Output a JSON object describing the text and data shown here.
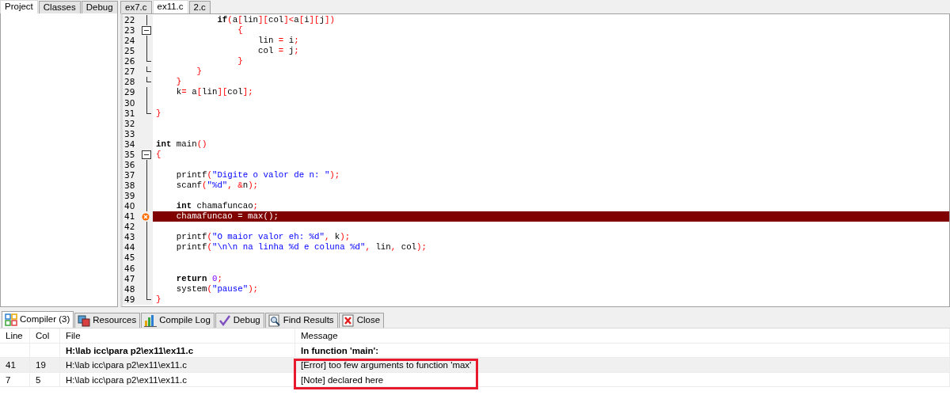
{
  "left_panel": {
    "tabs": [
      {
        "label": "Project",
        "selected": true
      },
      {
        "label": "Classes",
        "selected": false
      },
      {
        "label": "Debug",
        "selected": false
      }
    ]
  },
  "editor": {
    "tabs": [
      {
        "label": "ex7.c",
        "selected": false
      },
      {
        "label": "ex11.c",
        "selected": true
      },
      {
        "label": "2.c",
        "selected": false
      }
    ],
    "lines": [
      {
        "number": "22",
        "kind": "inside",
        "tokens": [
          {
            "kind": "kw",
            "text": "            if"
          },
          {
            "kind": "sym",
            "text": "("
          },
          {
            "kind": "id",
            "text": "a"
          },
          {
            "kind": "sym",
            "text": "["
          },
          {
            "kind": "id",
            "text": "lin"
          },
          {
            "kind": "sym",
            "text": "]["
          },
          {
            "kind": "id",
            "text": "col"
          },
          {
            "kind": "sym",
            "text": "]<"
          },
          {
            "kind": "id",
            "text": "a"
          },
          {
            "kind": "sym",
            "text": "["
          },
          {
            "kind": "id",
            "text": "i"
          },
          {
            "kind": "sym",
            "text": "]["
          },
          {
            "kind": "id",
            "text": "j"
          },
          {
            "kind": "sym",
            "text": "])"
          }
        ]
      },
      {
        "number": "23",
        "kind": "start",
        "tokens": [
          {
            "kind": "sym",
            "text": "                {"
          }
        ]
      },
      {
        "number": "24",
        "kind": "inside",
        "tokens": [
          {
            "kind": "id",
            "text": "                    lin "
          },
          {
            "kind": "sym",
            "text": "="
          },
          {
            "kind": "id",
            "text": " i"
          },
          {
            "kind": "sym",
            "text": ";"
          }
        ]
      },
      {
        "number": "25",
        "kind": "inside",
        "tokens": [
          {
            "kind": "id",
            "text": "                    col "
          },
          {
            "kind": "sym",
            "text": "="
          },
          {
            "kind": "id",
            "text": " j"
          },
          {
            "kind": "sym",
            "text": ";"
          }
        ]
      },
      {
        "number": "26",
        "kind": "end",
        "tokens": [
          {
            "kind": "sym",
            "text": "                }"
          }
        ]
      },
      {
        "number": "27",
        "kind": "end",
        "tokens": [
          {
            "kind": "sym",
            "text": "        }"
          }
        ]
      },
      {
        "number": "28",
        "kind": "end",
        "tokens": [
          {
            "kind": "sym",
            "text": "    }"
          }
        ]
      },
      {
        "number": "29",
        "kind": "inside",
        "tokens": [
          {
            "kind": "id",
            "text": "    k"
          },
          {
            "kind": "sym",
            "text": "="
          },
          {
            "kind": "id",
            "text": " a"
          },
          {
            "kind": "sym",
            "text": "["
          },
          {
            "kind": "id",
            "text": "lin"
          },
          {
            "kind": "sym",
            "text": "]["
          },
          {
            "kind": "id",
            "text": "col"
          },
          {
            "kind": "sym",
            "text": "];"
          }
        ]
      },
      {
        "number": "30",
        "kind": "inside"
      },
      {
        "number": "31",
        "kind": "end",
        "tokens": [
          {
            "kind": "sym",
            "text": "}"
          }
        ]
      },
      {
        "number": "32",
        "kind": "none"
      },
      {
        "number": "33",
        "kind": "none"
      },
      {
        "number": "34",
        "kind": "none",
        "tokens": [
          {
            "kind": "kw",
            "text": "int"
          },
          {
            "kind": "id",
            "text": " main"
          },
          {
            "kind": "sym",
            "text": "()"
          }
        ]
      },
      {
        "number": "35",
        "kind": "start",
        "tokens": [
          {
            "kind": "sym",
            "text": "{"
          }
        ]
      },
      {
        "number": "36",
        "kind": "inside"
      },
      {
        "number": "37",
        "kind": "inside",
        "tokens": [
          {
            "kind": "id",
            "text": "    printf"
          },
          {
            "kind": "sym",
            "text": "("
          },
          {
            "kind": "str",
            "text": "\"Digite o valor de n: \""
          },
          {
            "kind": "sym",
            "text": ");"
          }
        ]
      },
      {
        "number": "38",
        "kind": "inside",
        "tokens": [
          {
            "kind": "id",
            "text": "    scanf"
          },
          {
            "kind": "sym",
            "text": "("
          },
          {
            "kind": "str",
            "text": "\"%d\""
          },
          {
            "kind": "sym",
            "text": ", &"
          },
          {
            "kind": "id",
            "text": "n"
          },
          {
            "kind": "sym",
            "text": ");"
          }
        ]
      },
      {
        "number": "39",
        "kind": "inside"
      },
      {
        "number": "40",
        "kind": "inside",
        "tokens": [
          {
            "kind": "kw",
            "text": "    int"
          },
          {
            "kind": "id",
            "text": " chamafuncao"
          },
          {
            "kind": "sym",
            "text": ";"
          }
        ]
      },
      {
        "number": "41",
        "kind": "inside",
        "error": true,
        "tokens": [
          {
            "kind": "id",
            "text": "    chamafuncao "
          },
          {
            "kind": "sym",
            "text": "="
          },
          {
            "kind": "id",
            "text": " max"
          },
          {
            "kind": "sym",
            "text": "();"
          }
        ]
      },
      {
        "number": "42",
        "kind": "inside"
      },
      {
        "number": "43",
        "kind": "inside",
        "tokens": [
          {
            "kind": "id",
            "text": "    printf"
          },
          {
            "kind": "sym",
            "text": "("
          },
          {
            "kind": "str",
            "text": "\"O maior valor eh: %d\""
          },
          {
            "kind": "sym",
            "text": ", "
          },
          {
            "kind": "id",
            "text": "k"
          },
          {
            "kind": "sym",
            "text": ");"
          }
        ]
      },
      {
        "number": "44",
        "kind": "inside",
        "tokens": [
          {
            "kind": "id",
            "text": "    printf"
          },
          {
            "kind": "sym",
            "text": "("
          },
          {
            "kind": "str",
            "text": "\"\\n\\n na linha %d e coluna %d\""
          },
          {
            "kind": "sym",
            "text": ", "
          },
          {
            "kind": "id",
            "text": "lin"
          },
          {
            "kind": "sym",
            "text": ", "
          },
          {
            "kind": "id",
            "text": "col"
          },
          {
            "kind": "sym",
            "text": ");"
          }
        ]
      },
      {
        "number": "45",
        "kind": "inside"
      },
      {
        "number": "46",
        "kind": "inside"
      },
      {
        "number": "47",
        "kind": "inside",
        "tokens": [
          {
            "kind": "kw",
            "text": "    return"
          },
          {
            "kind": "num",
            "text": " 0"
          },
          {
            "kind": "sym",
            "text": ";"
          }
        ]
      },
      {
        "number": "48",
        "kind": "inside",
        "tokens": [
          {
            "kind": "id",
            "text": "    system"
          },
          {
            "kind": "sym",
            "text": "("
          },
          {
            "kind": "str",
            "text": "\"pause\""
          },
          {
            "kind": "sym",
            "text": ");"
          }
        ]
      },
      {
        "number": "49",
        "kind": "end",
        "tokens": [
          {
            "kind": "sym",
            "text": "}"
          }
        ]
      }
    ]
  },
  "bottom_tabs": [
    {
      "label": "Compiler (3)",
      "kind": "grid",
      "selected": true
    },
    {
      "label": "Resources",
      "kind": "resources",
      "selected": false
    },
    {
      "label": "Compile Log",
      "kind": "chart",
      "selected": false
    },
    {
      "label": "Debug",
      "kind": "check",
      "selected": false
    },
    {
      "label": "Find Results",
      "kind": "find",
      "selected": false
    },
    {
      "label": "Close",
      "kind": "close",
      "selected": false
    }
  ],
  "compiler_table": {
    "columns": [
      "Line",
      "Col",
      "File",
      "Message"
    ],
    "rows": [
      {
        "cells": [
          "",
          "",
          "H:\\lab icc\\para p2\\ex11\\ex11.c",
          "In function 'main':"
        ],
        "bold": true,
        "selected": false,
        "highlighted": false
      },
      {
        "cells": [
          "41",
          "19",
          "H:\\lab icc\\para p2\\ex11\\ex11.c",
          "[Error] too few arguments to function 'max'"
        ],
        "bold": false,
        "selected": true,
        "highlighted": true
      },
      {
        "cells": [
          "7",
          "5",
          "H:\\lab icc\\para p2\\ex11\\ex11.c",
          "[Note] declared here"
        ],
        "bold": false,
        "selected": false,
        "highlighted": true
      }
    ]
  }
}
